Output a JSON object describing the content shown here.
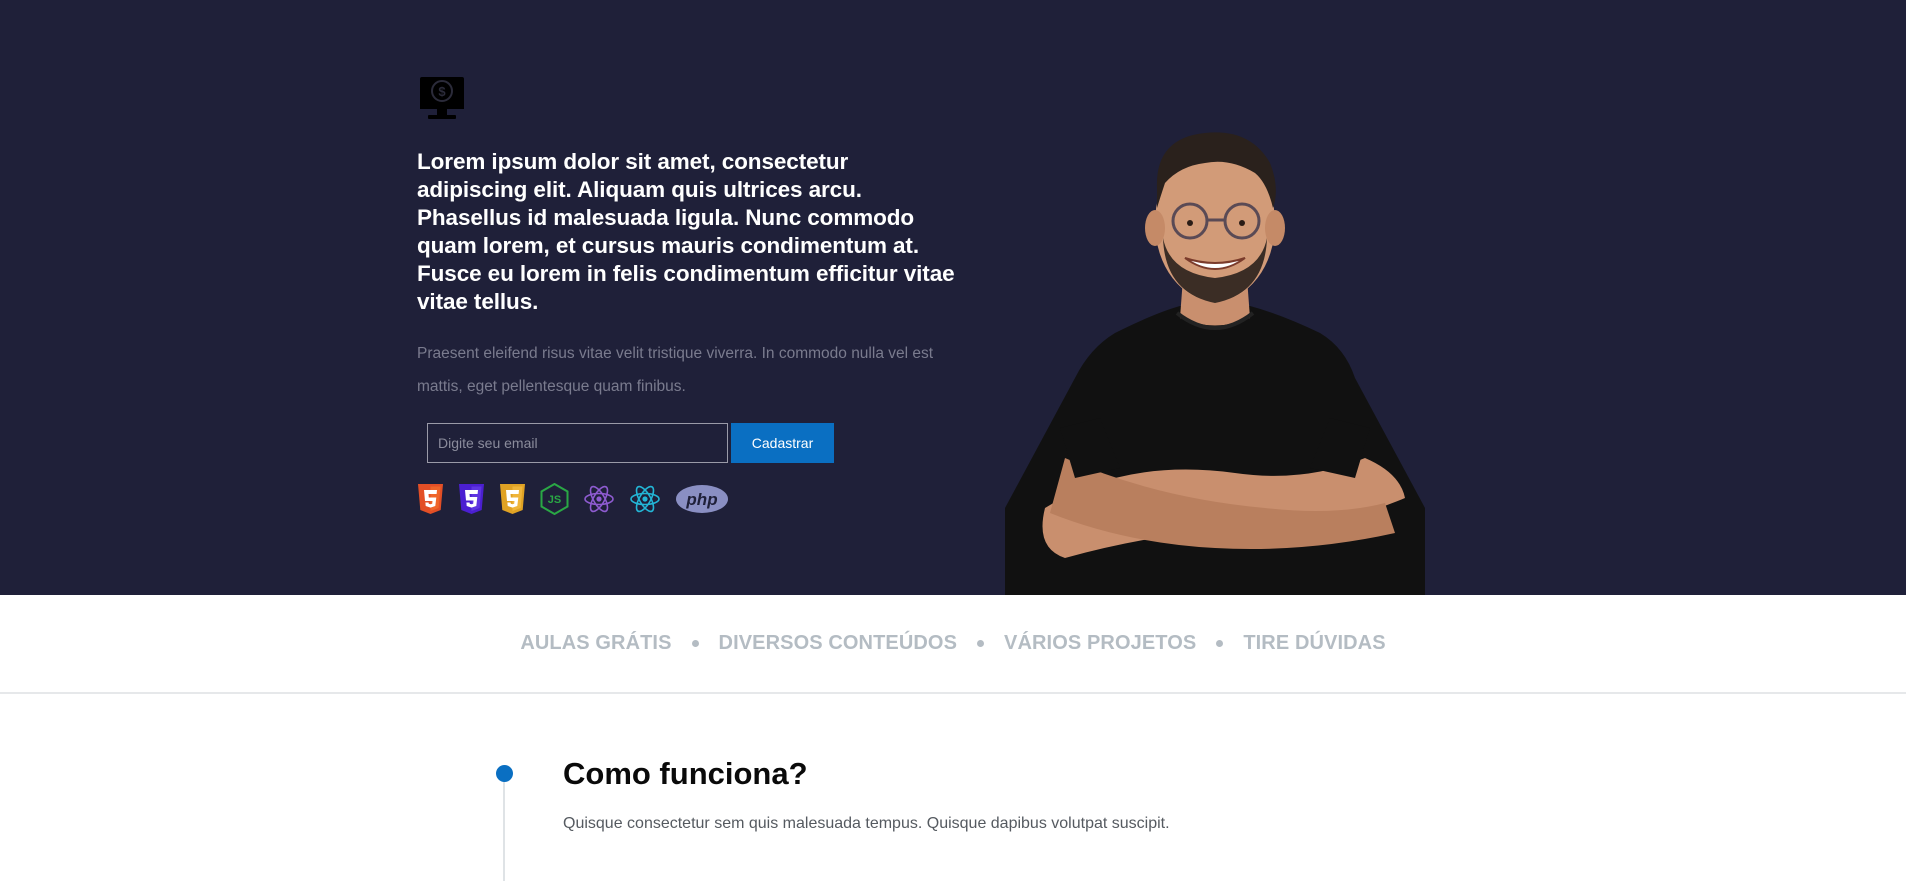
{
  "hero": {
    "logo_icon": "monitor-dollar-icon",
    "headline": "Lorem ipsum dolor sit amet, consectetur adipiscing elit. Aliquam quis ultrices arcu. Phasellus id malesuada ligula. Nunc commodo quam lorem, et cursus mauris condimentum at. Fusce eu lorem in felis condimentum efficitur vitae vitae tellus.",
    "subtext": "Praesent eleifend risus vitae velit tristique viverra. In commodo nulla vel est mattis, eget pellentesque quam finibus.",
    "email_placeholder": "Digite seu email",
    "email_value": "",
    "signup_label": "Cadastrar",
    "tech_icons": [
      "html5-icon",
      "css3-icon",
      "html5-icon",
      "nodejs-icon",
      "react-icon",
      "react-icon",
      "php-icon"
    ],
    "php_label": "php",
    "portrait": "person-portrait"
  },
  "features": {
    "items": [
      "AULAS GRÁTIS",
      "DIVERSOS CONTEÚDOS",
      "VÁRIOS PROJETOS",
      "TIRE DÚVIDAS"
    ]
  },
  "how": {
    "title": "Como funciona?",
    "text": "Quisque consectetur sem quis malesuada tempus. Quisque dapibus volutpat suscipit."
  },
  "colors": {
    "hero_bg": "#1f2039",
    "accent": "#0a6fc2",
    "feature_text": "#b4bcc3"
  }
}
